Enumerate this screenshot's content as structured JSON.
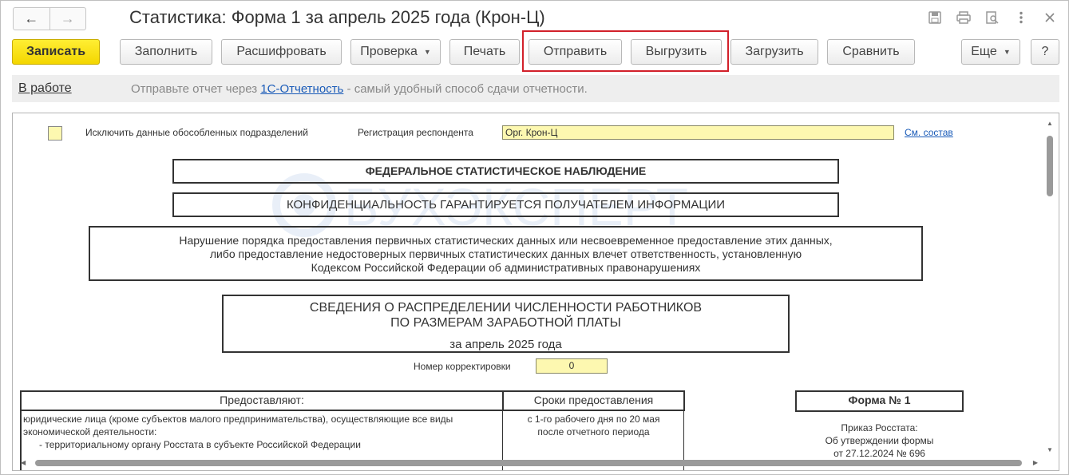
{
  "window": {
    "title": "Статистика: Форма 1 за апрель 2025 года (Крон-Ц)",
    "nav": {
      "back_icon": "←",
      "forward_icon": "→"
    },
    "title_icons": [
      "save-icon",
      "print-icon",
      "preview-icon",
      "more-vertical-icon",
      "close-icon"
    ]
  },
  "toolbar": {
    "save": "Записать",
    "fill": "Заполнить",
    "decode": "Расшифровать",
    "check": "Проверка",
    "print": "Печать",
    "send": "Отправить",
    "export": "Выгрузить",
    "import": "Загрузить",
    "compare": "Сравнить",
    "more": "Еще",
    "help": "?"
  },
  "infobar": {
    "status": "В работе",
    "text_before": "Отправьте отчет через ",
    "link": "1С-Отчетность",
    "text_after": " - самый удобный способ сдачи отчетности."
  },
  "document": {
    "exclude_label": "Исключить данные обособленных подразделений",
    "respondent_label": "Регистрация респондента",
    "respondent_value": "Орг. Крон-Ц",
    "see_list": "См. состав",
    "federal": "ФЕДЕРАЛЬНОЕ СТАТИСТИЧЕСКОЕ НАБЛЮДЕНИЕ",
    "confidential": "КОНФИДЕНЦИАЛЬНОСТЬ ГАРАНТИРУЕТСЯ ПОЛУЧАТЕЛЕМ ИНФОРМАЦИИ",
    "warning": [
      "Нарушение порядка предоставления первичных статистических данных или несвоевременное предоставление этих данных,",
      "либо предоставление недостоверных первичных статистических данных влечет ответственность, установленную",
      "Кодексом Российской Федерации об административных правонарушениях"
    ],
    "report_title": [
      "СВЕДЕНИЯ О РАСПРЕДЕЛЕНИИ ЧИСЛЕННОСТИ РАБОТНИКОВ",
      "ПО РАЗМЕРАМ ЗАРАБОТНОЙ ПЛАТЫ"
    ],
    "period": "за апрель 2025 года",
    "correction_label": "Номер корректировки",
    "correction_value": "0",
    "table": {
      "col1_header": "Предоставляют:",
      "col2_header": "Сроки предоставления",
      "col1_lines": [
        "юридические лица (кроме субъектов малого предпринимательства), осуществляющие все виды",
        "экономической деятельности:",
        "- территориальному органу Росстата в субъекте Российской Федерации"
      ],
      "col2_lines": [
        "с 1-го рабочего дня по 20 мая",
        "после отчетного периода"
      ]
    },
    "form_no": "Форма № 1",
    "order_lines": [
      "Приказ Росстата:",
      "Об утверждении формы",
      "от 27.12.2024 № 696"
    ],
    "watermark": "БУХЭКСПЕРТ"
  }
}
